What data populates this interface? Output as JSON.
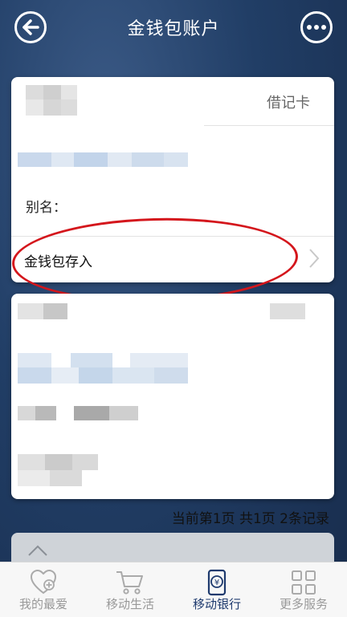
{
  "header": {
    "title": "金钱包账户"
  },
  "card1": {
    "card_type": "借记卡",
    "alias_label": "别名：",
    "deposit_label": "金钱包存入"
  },
  "records_text": "当前第1页  共1页  2条记录",
  "tabbar": [
    {
      "label": "我的最爱",
      "icon": "heart-plus-icon"
    },
    {
      "label": "移动生活",
      "icon": "cart-icon"
    },
    {
      "label": "移动银行",
      "icon": "yuan-phone-icon",
      "active": true
    },
    {
      "label": "更多服务",
      "icon": "grid-icon"
    }
  ],
  "colors": {
    "header_bg": "#213e66",
    "annotation": "#d4161c",
    "active_tab": "#1e3a6e"
  }
}
